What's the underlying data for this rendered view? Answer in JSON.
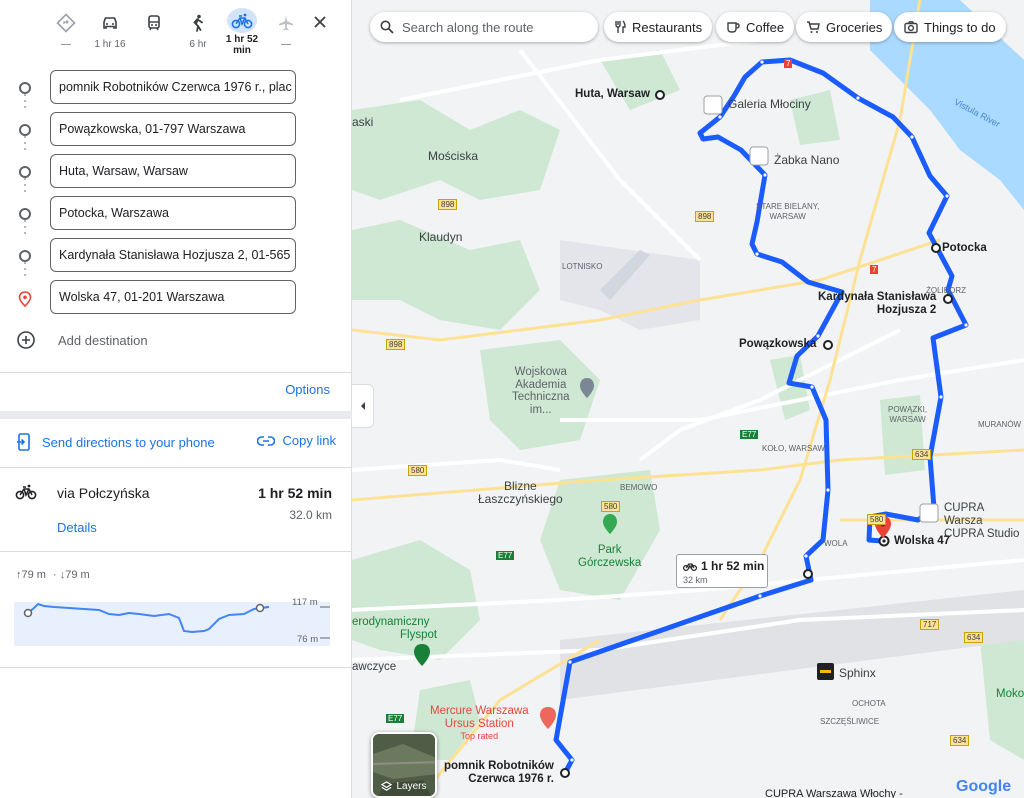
{
  "modes": [
    {
      "name": "best-route",
      "label": "—"
    },
    {
      "name": "driving",
      "label": "1 hr 16"
    },
    {
      "name": "transit",
      "label": ""
    },
    {
      "name": "walking",
      "label": "6 hr"
    },
    {
      "name": "cycling",
      "label": "1 hr 52 min",
      "active": true
    },
    {
      "name": "flights",
      "label": "—"
    }
  ],
  "stops": [
    "pomnik Robotników Czerwca 1976 r., plac",
    "Powązkowska, 01-797 Warszawa",
    "Huta, Warsaw, Warsaw",
    "Potocka, Warszawa",
    "Kardynała Stanisława Hozjusza 2, 01-565",
    "Wolska 47, 01-201 Warszawa"
  ],
  "add_destination": "Add destination",
  "options": "Options",
  "send_directions": "Send directions to your phone",
  "copy_link": "Copy link",
  "route": {
    "via": "via Połczyńska",
    "duration": "1 hr 52 min",
    "distance": "32.0 km",
    "details": "Details"
  },
  "elevation": {
    "ascent": "79 m",
    "descent": "79 m",
    "max": "117 m",
    "min": "76 m"
  },
  "search_placeholder": "Search along the route",
  "chips": [
    "Restaurants",
    "Coffee",
    "Groceries",
    "Things to do"
  ],
  "map_labels": {
    "huta": "Huta, Warsaw",
    "galeria": "Galeria Młociny",
    "zabka": "Żabka Nano",
    "moscicka": "Mościska",
    "klaudyn": "Klaudyn",
    "stare_bielany": "STARE BIELANY,",
    "warsaw": "WARSAW",
    "potocka": "Potocka",
    "zoliborz": "ŻOLIBORZ",
    "kardynala_1": "Kardynała Stanisława",
    "kardynala_2": "Hozjusza 2",
    "lotnisko": "LOTNISKO",
    "powazkowska": "Powązkowska",
    "wat_1": "Wojskowa",
    "wat_2": "Akademia",
    "wat_3": "Techniczna",
    "wat_4": "im...",
    "powazki_1": "POWĄZKI,",
    "powazki_2": "WARSAW",
    "muranow": "MURANÓW",
    "kolo": "KOŁO, WARSAW",
    "blizne_1": "Blizne",
    "blizne_2": "Łaszczyńskiego",
    "bemowo": "BEMOWO",
    "park_1": "Park",
    "park_2": "Górczewska",
    "cupra_1": "CUPRA Warsza",
    "cupra_2": "CUPRA Studio",
    "wolska": "Wolska 47",
    "wola": "WOLA",
    "aero_1": "erodynamiczny",
    "aero_2": "Flyspot",
    "awczyce": "awczyce",
    "mercure_1": "Mercure Warszawa",
    "mercure_2": "Ursus Station",
    "top_rated": "Top rated",
    "sphinx": "Sphinx",
    "ochota": "OCHOTA",
    "szczesliwice": "SZCZĘŚLIWICE",
    "mokot": "Moko",
    "pomnik_1": "pomnik Robotników",
    "pomnik_2": "Czerwca 1976 r.",
    "vistula": "Vistula River",
    "aski": "aski"
  },
  "road_shields": [
    "898",
    "898",
    "898",
    "7",
    "7",
    "E77",
    "580",
    "580",
    "E77",
    "634",
    "717",
    "634",
    "634",
    "E77",
    "580"
  ],
  "duration_box": {
    "time": "1 hr 52 min",
    "dist": "32 km"
  },
  "layers_label": "Layers",
  "google_logo": "Google",
  "bottom_text": "CUPRA Warszawa Włochy -",
  "colors": {
    "route": "#1a5cff",
    "accent": "#1a73e8",
    "pin": "#ea4335"
  }
}
